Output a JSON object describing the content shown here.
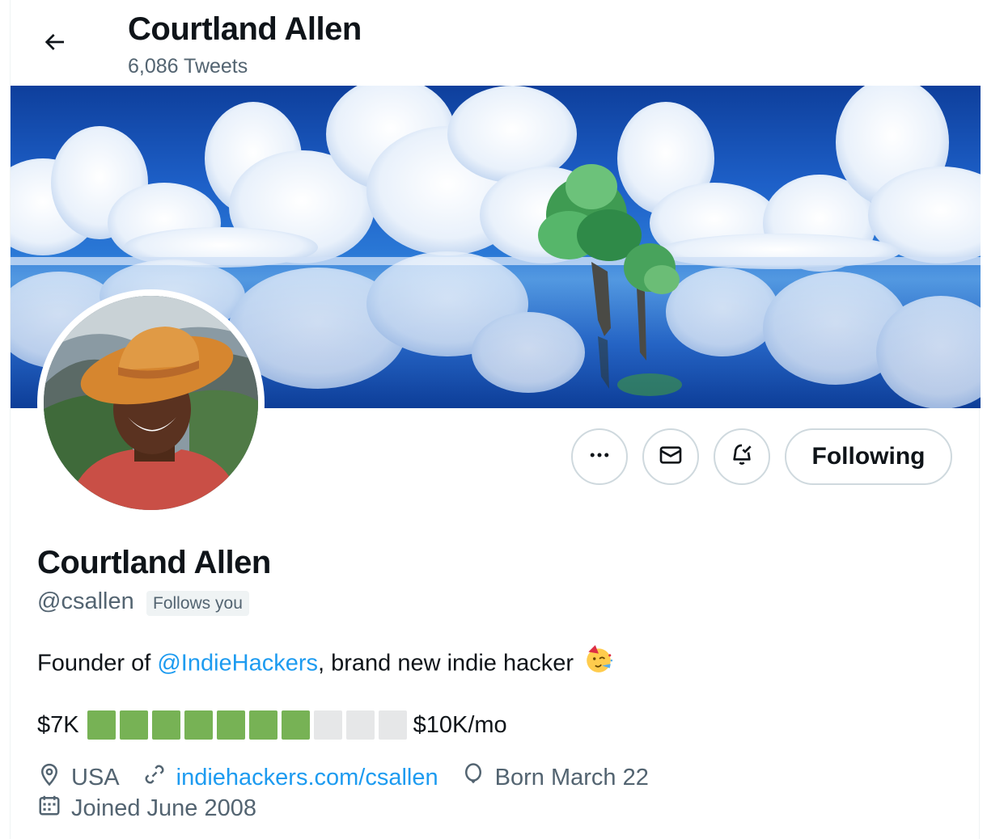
{
  "header": {
    "title": "Courtland Allen",
    "tweet_count": "6,086 Tweets"
  },
  "actions": {
    "more_label": "more-options",
    "following_label": "Following"
  },
  "profile": {
    "name": "Courtland Allen",
    "handle": "@csallen",
    "follows_you": "Follows you",
    "bio_prefix": "Founder of ",
    "bio_mention": "@IndieHackers",
    "bio_suffix": ", brand new indie hacker",
    "progress": {
      "start_label": "$7K",
      "end_label": "$10K/mo",
      "filled_blocks": 7,
      "total_blocks": 10,
      "filled_color": "#77b255",
      "empty_color": "#e6e7e8"
    },
    "location": "USA",
    "website": "indiehackers.com/csallen",
    "birthday": "Born March 22",
    "joined": "Joined June 2008"
  },
  "colors": {
    "accent": "#1d9bf0",
    "secondary_text": "#536471",
    "border": "#cfd9de"
  },
  "icons": {
    "back": "arrow-left-icon",
    "more": "ellipsis-icon",
    "message": "envelope-icon",
    "notify": "bell-check-icon",
    "location": "map-pin-icon",
    "link": "link-icon",
    "birthday": "balloon-icon",
    "joined": "calendar-icon",
    "party": "partying-face-emoji"
  }
}
